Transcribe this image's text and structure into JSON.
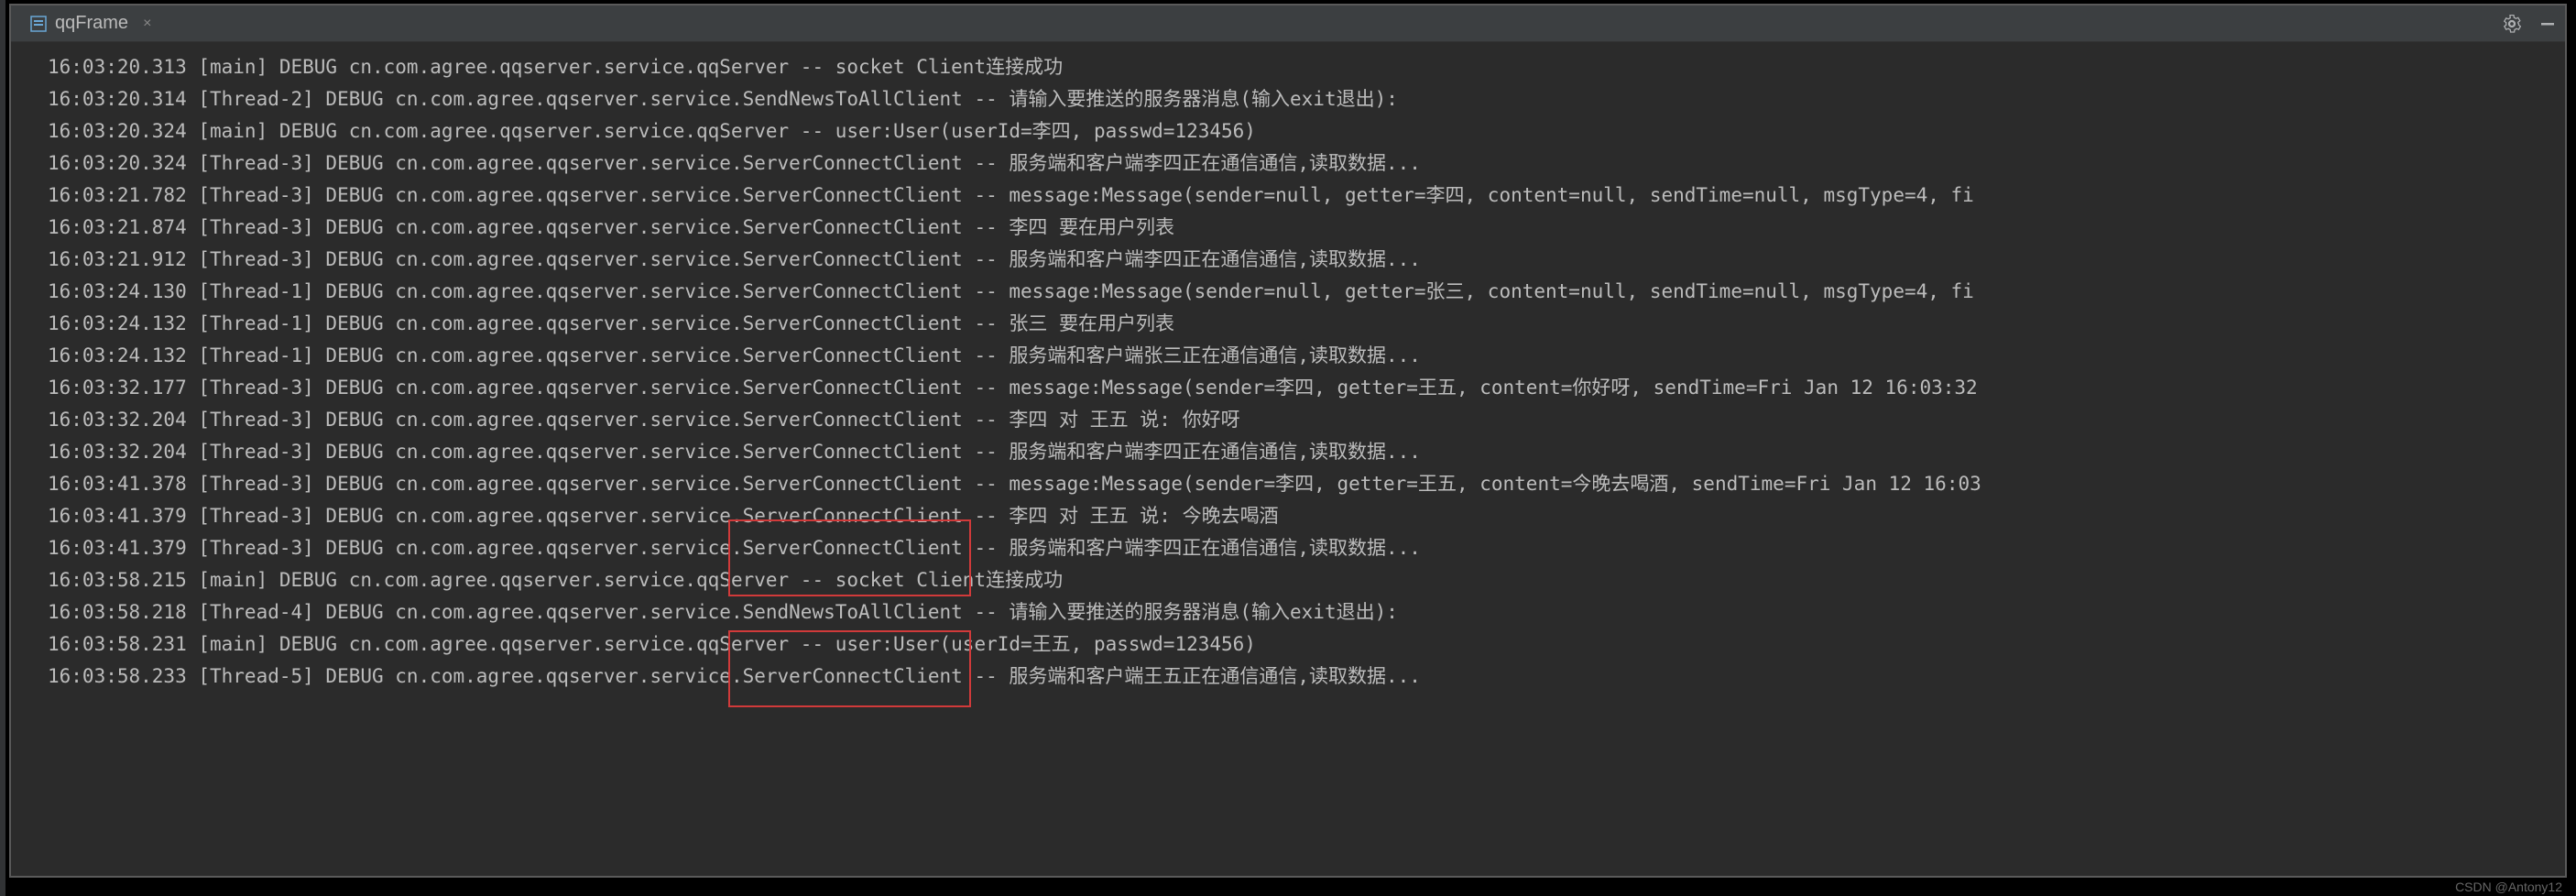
{
  "tab": {
    "title": "qqFrame",
    "close": "×"
  },
  "watermark": "CSDN @Antony12",
  "logs": [
    "16:03:20.313 [main] DEBUG cn.com.agree.qqserver.service.qqServer -- socket Client连接成功",
    "16:03:20.314 [Thread-2] DEBUG cn.com.agree.qqserver.service.SendNewsToAllClient -- 请输入要推送的服务器消息(输入exit退出):",
    "16:03:20.324 [main] DEBUG cn.com.agree.qqserver.service.qqServer -- user:User(userId=李四, passwd=123456)",
    "16:03:20.324 [Thread-3] DEBUG cn.com.agree.qqserver.service.ServerConnectClient -- 服务端和客户端李四正在通信通信,读取数据...",
    "16:03:21.782 [Thread-3] DEBUG cn.com.agree.qqserver.service.ServerConnectClient -- message:Message(sender=null, getter=李四, content=null, sendTime=null, msgType=4, fi",
    "16:03:21.874 [Thread-3] DEBUG cn.com.agree.qqserver.service.ServerConnectClient -- 李四 要在用户列表",
    "16:03:21.912 [Thread-3] DEBUG cn.com.agree.qqserver.service.ServerConnectClient -- 服务端和客户端李四正在通信通信,读取数据...",
    "16:03:24.130 [Thread-1] DEBUG cn.com.agree.qqserver.service.ServerConnectClient -- message:Message(sender=null, getter=张三, content=null, sendTime=null, msgType=4, fi",
    "16:03:24.132 [Thread-1] DEBUG cn.com.agree.qqserver.service.ServerConnectClient -- 张三 要在用户列表",
    "16:03:24.132 [Thread-1] DEBUG cn.com.agree.qqserver.service.ServerConnectClient -- 服务端和客户端张三正在通信通信,读取数据...",
    "16:03:32.177 [Thread-3] DEBUG cn.com.agree.qqserver.service.ServerConnectClient -- message:Message(sender=李四, getter=王五, content=你好呀, sendTime=Fri Jan 12 16:03:32",
    "16:03:32.204 [Thread-3] DEBUG cn.com.agree.qqserver.service.ServerConnectClient -- 李四 对 王五 说: 你好呀",
    "16:03:32.204 [Thread-3] DEBUG cn.com.agree.qqserver.service.ServerConnectClient -- 服务端和客户端李四正在通信通信,读取数据...",
    "16:03:41.378 [Thread-3] DEBUG cn.com.agree.qqserver.service.ServerConnectClient -- message:Message(sender=李四, getter=王五, content=今晚去喝酒, sendTime=Fri Jan 12 16:03",
    "16:03:41.379 [Thread-3] DEBUG cn.com.agree.qqserver.service.ServerConnectClient -- 李四 对 王五 说: 今晚去喝酒",
    "16:03:41.379 [Thread-3] DEBUG cn.com.agree.qqserver.service.ServerConnectClient -- 服务端和客户端李四正在通信通信,读取数据...",
    "16:03:58.215 [main] DEBUG cn.com.agree.qqserver.service.qqServer -- socket Client连接成功",
    "16:03:58.218 [Thread-4] DEBUG cn.com.agree.qqserver.service.SendNewsToAllClient -- 请输入要推送的服务器消息(输入exit退出):",
    "16:03:58.231 [main] DEBUG cn.com.agree.qqserver.service.qqServer -- user:User(userId=王五, passwd=123456)",
    "16:03:58.233 [Thread-5] DEBUG cn.com.agree.qqserver.service.ServerConnectClient -- 服务端和客户端王五正在通信通信,读取数据..."
  ]
}
